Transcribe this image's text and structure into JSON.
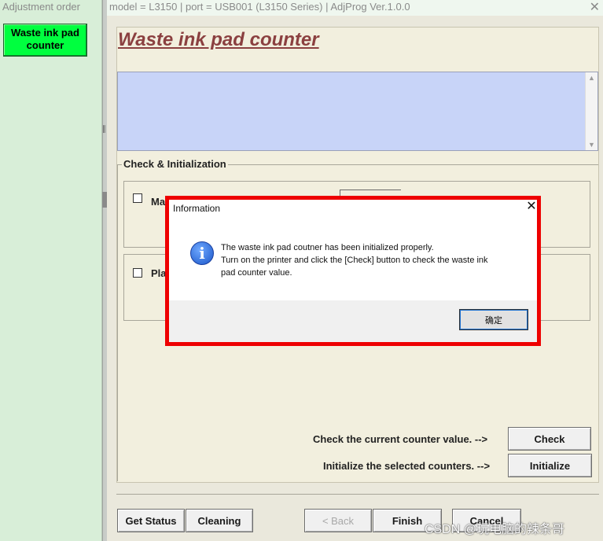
{
  "left_panel": {
    "title": "Adjustment order",
    "items": [
      {
        "label": "Waste ink pad counter"
      }
    ],
    "splitter_glyph": "∥"
  },
  "window": {
    "title": "model = L3150 | port = USB001 (L3150 Series) | AdjProg Ver.1.0.0",
    "close_glyph": "✕"
  },
  "main": {
    "heading": "Waste ink pad counter",
    "group_label": "Check & Initialization",
    "counters": [
      {
        "label": "Ma",
        "checked": false
      },
      {
        "label": "Pla",
        "checked": false
      }
    ],
    "check_prompt": "Check the current counter value. -->",
    "init_prompt": "Initialize the selected counters. -->",
    "check_button": "Check",
    "init_button": "Initialize"
  },
  "footer": {
    "get_status": "Get Status",
    "cleaning": "Cleaning",
    "back": "< Back",
    "finish": "Finish",
    "cancel": "Cancel"
  },
  "dialog": {
    "title": "Information",
    "icon": "info-icon",
    "icon_glyph": "i",
    "close_glyph": "✕",
    "message": [
      "The waste ink pad coutner has been initialized properly.",
      "Turn on the printer and click the [Check] button to check the waste ink",
      "pad counter value."
    ],
    "ok_button": "确定",
    "highlight_color": "#ee0000"
  },
  "watermark": "CSDN @玩电脑的辣条哥",
  "colors": {
    "selected_item": "#00ff3f",
    "heading": "#8b4040",
    "info_box": "#c8d4f8"
  }
}
